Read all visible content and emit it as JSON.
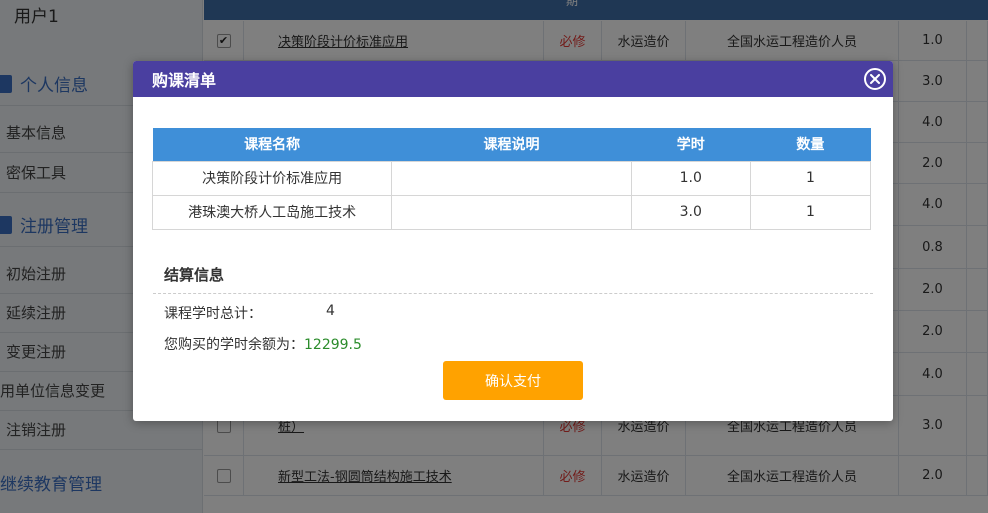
{
  "sidebar": {
    "user": "用户1",
    "sections": [
      {
        "label": "个人信息",
        "items": [
          "基本信息",
          "密保工具"
        ]
      },
      {
        "label": "注册管理",
        "items": [
          "初始注册",
          "延续注册",
          "变更注册",
          "用单位信息变更",
          "注销注册"
        ]
      },
      {
        "label": "继续教育管理",
        "items": []
      }
    ]
  },
  "background_table": {
    "header_fragment": "期",
    "rows": [
      {
        "checked": true,
        "name": "决策阶段计价标准应用",
        "type": "必修",
        "category": "水运造价",
        "audience": "全国水运工程造价人员",
        "hours": "1.0"
      },
      {
        "checked": false,
        "name": "",
        "type": "",
        "category": "",
        "audience": "",
        "hours": "3.0"
      },
      {
        "checked": false,
        "name": "",
        "type": "",
        "category": "",
        "audience": "",
        "hours": "4.0"
      },
      {
        "checked": false,
        "name": "",
        "type": "",
        "category": "",
        "audience": "",
        "hours": "2.0"
      },
      {
        "checked": false,
        "name": "",
        "type": "",
        "category": "",
        "audience": "",
        "hours": "4.0"
      },
      {
        "checked": false,
        "name": "",
        "type": "",
        "category": "",
        "audience": "",
        "hours": "0.8"
      },
      {
        "checked": false,
        "name": "",
        "type": "",
        "category": "",
        "audience": "",
        "hours": "2.0"
      },
      {
        "checked": false,
        "name": "",
        "type": "",
        "category": "",
        "audience": "",
        "hours": "2.0"
      },
      {
        "checked": false,
        "name": "",
        "type": "",
        "category": "",
        "audience": "",
        "hours": "4.0"
      },
      {
        "checked": false,
        "name": "桩）",
        "type": "必修",
        "category": "水运造价",
        "audience": "全国水运工程造价人员",
        "hours": "3.0"
      },
      {
        "checked": false,
        "name": "新型工法-钢圆筒结构施工技术",
        "type": "必修",
        "category": "水运造价",
        "audience": "全国水运工程造价人员",
        "hours": "2.0"
      }
    ]
  },
  "modal": {
    "title": "购课清单",
    "columns": [
      "课程名称",
      "课程说明",
      "学时",
      "数量"
    ],
    "rows": [
      {
        "name": "决策阶段计价标准应用",
        "desc": "",
        "hours": "1.0",
        "qty": "1"
      },
      {
        "name": "港珠澳大桥人工岛施工技术",
        "desc": "",
        "hours": "3.0",
        "qty": "1"
      }
    ],
    "settlement_title": "结算信息",
    "total_label": "课程学时总计：",
    "total_value": "4",
    "balance_label": "您购买的学时余额为：",
    "balance_value": "12299.5",
    "pay_button": "确认支付"
  },
  "colors": {
    "modal_header": "#4a3fa0",
    "table_header": "#3f8fd8",
    "pay_button": "#ffa200",
    "balance_value": "#2b8c2b",
    "required_text": "#e53935"
  },
  "icons": {
    "close": "close-circle-icon",
    "checkbox": "checkbox-icon"
  }
}
